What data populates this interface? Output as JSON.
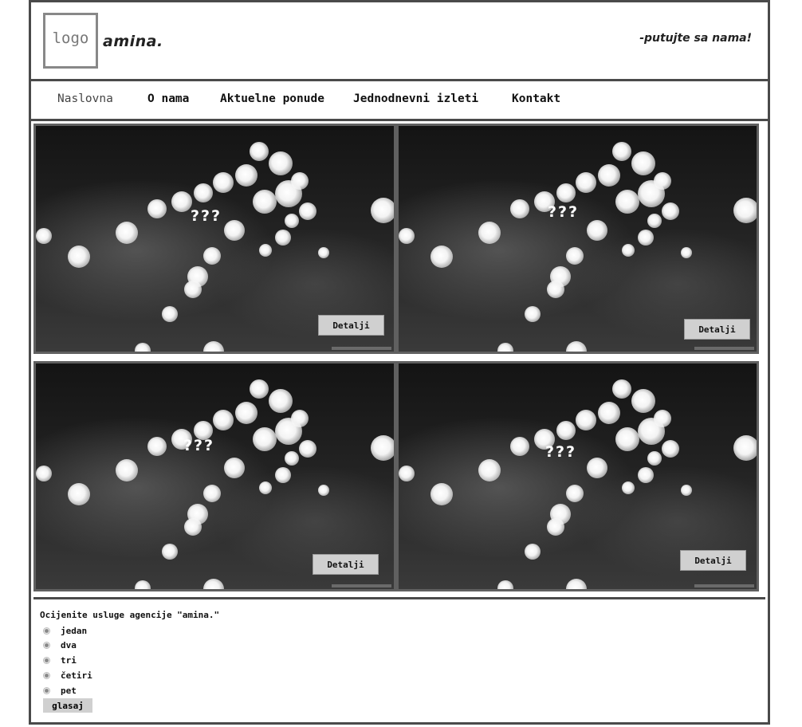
{
  "header": {
    "logo_text": "logo",
    "brand": "amina.",
    "slogan": "-putujte sa nama!"
  },
  "nav": {
    "items": [
      {
        "label": "Naslovna",
        "active": true
      },
      {
        "label": "O nama",
        "active": false
      },
      {
        "label": "Aktuelne ponude",
        "active": false
      },
      {
        "label": "Jednodnevni izleti",
        "active": false
      },
      {
        "label": "Kontakt",
        "active": false
      }
    ]
  },
  "gallery": {
    "tiles": [
      {
        "title": "???",
        "button_label": "Detalji"
      },
      {
        "title": "???",
        "button_label": "Detalji"
      },
      {
        "title": "???",
        "button_label": "Detalji"
      },
      {
        "title": "???",
        "button_label": "Detalji"
      }
    ]
  },
  "poll": {
    "question": "Ocijenite usluge agencije \"amina.\"",
    "options": [
      "jedan",
      "dva",
      "tri",
      "četiri",
      "pet"
    ],
    "submit_label": "glasaj"
  },
  "colors": {
    "border": "#4a4a4a",
    "button_bg": "#d0d0d0",
    "logo_border": "#888888"
  }
}
